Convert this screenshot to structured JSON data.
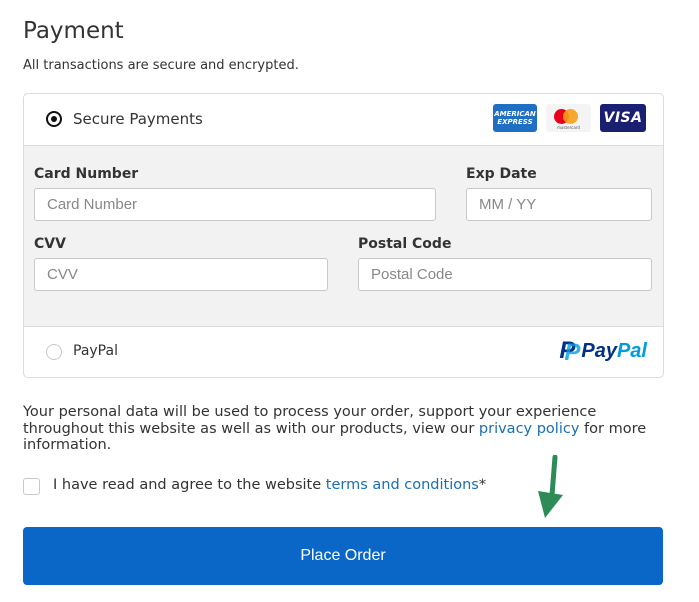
{
  "header": {
    "title": "Payment",
    "subtitle": "All transactions are secure and encrypted."
  },
  "payment_methods": {
    "secure": {
      "label": "Secure Payments",
      "selected": true,
      "card_logos": {
        "amex_line1": "AMERICAN",
        "amex_line2": "EXPRESS",
        "mastercard": "mastercard",
        "visa": "VISA"
      }
    },
    "paypal": {
      "label": "PayPal",
      "selected": false,
      "logo_mark": "P",
      "logo_word_a": "Pay",
      "logo_word_b": "Pal"
    }
  },
  "card_form": {
    "card_number": {
      "label": "Card Number",
      "placeholder": "Card Number",
      "value": ""
    },
    "exp_date": {
      "label": "Exp Date",
      "placeholder": "MM / YY",
      "value": ""
    },
    "cvv": {
      "label": "CVV",
      "placeholder": "CVV",
      "value": ""
    },
    "postal_code": {
      "label": "Postal Code",
      "placeholder": "Postal Code",
      "value": ""
    }
  },
  "privacy": {
    "text_before": "Your personal data will be used to process your order, support your experience throughout this website as well as with our products, view our ",
    "link": "privacy policy",
    "text_after": " for more information."
  },
  "terms": {
    "checked": false,
    "text_before": "I have read and agree to the website ",
    "link": "terms and conditions",
    "required_mark": "*"
  },
  "place_order_label": "Place Order",
  "colors": {
    "primary_button": "#0a66c7",
    "link": "#1a6eb5",
    "arrow": "#2e8b57",
    "form_bg": "#f2f2f2"
  },
  "icons": {
    "arrow": "arrow-down-icon"
  }
}
